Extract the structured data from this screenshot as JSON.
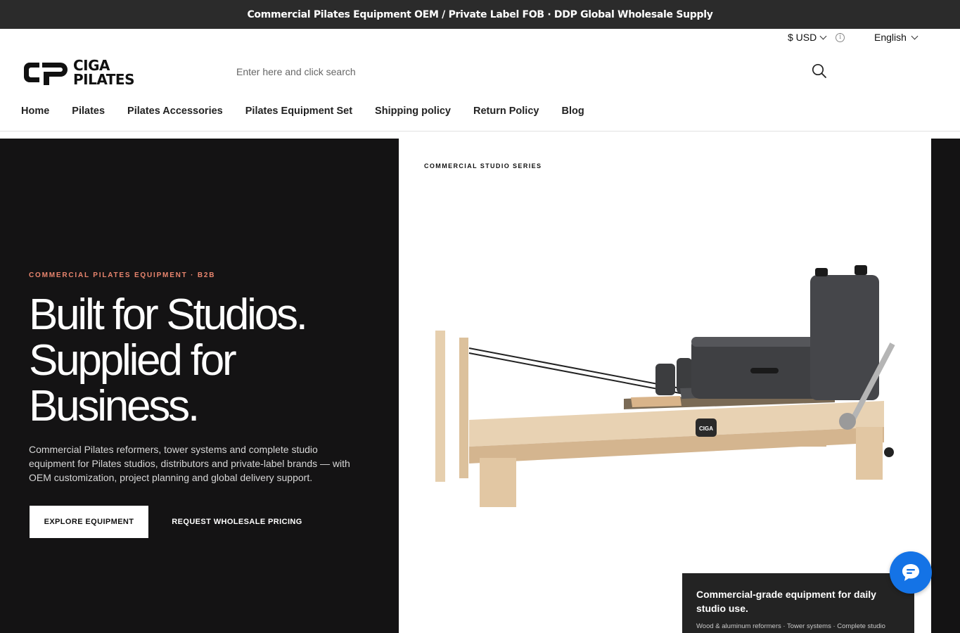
{
  "announcement": "Commercial Pilates Equipment OEM / Private Label FOB · DDP Global Wholesale Supply",
  "utility": {
    "currency": "$ USD",
    "language": "English"
  },
  "logo": {
    "line1": "CIGA",
    "line2": "PILATES"
  },
  "search": {
    "placeholder": "Enter here and click search"
  },
  "nav": {
    "items": [
      "Home",
      "Pilates",
      "Pilates Accessories",
      "Pilates Equipment Set",
      "Shipping policy",
      "Return Policy",
      "Blog"
    ]
  },
  "hero": {
    "eyebrow": "COMMERCIAL PILATES EQUIPMENT · B2B",
    "headline": [
      "Built for Studios.",
      "Supplied for",
      "Business."
    ],
    "subtext": "Commercial Pilates reformers, tower systems and complete studio equipment for Pilates studios, distributors and private-label brands — with OEM customization, project planning and global delivery support.",
    "primary_cta": "EXPLORE EQUIPMENT",
    "secondary_cta": "REQUEST WHOLESALE PRICING",
    "series_label": "COMMERCIAL STUDIO SERIES",
    "product_badge": "CIGA",
    "feature_card": {
      "title": "Commercial-grade equipment for daily studio use.",
      "subtitle": "Wood & aluminum reformers · Tower systems · Complete studio"
    }
  },
  "icons": {
    "search": "search-icon",
    "chat": "chat-icon",
    "info": "info-icon",
    "chevron": "chevron-down-icon"
  },
  "colors": {
    "announcement_bg": "#2b2b2b",
    "hero_bg": "#141314",
    "eyebrow": "#e9856e",
    "chat_button": "#1473e6"
  }
}
